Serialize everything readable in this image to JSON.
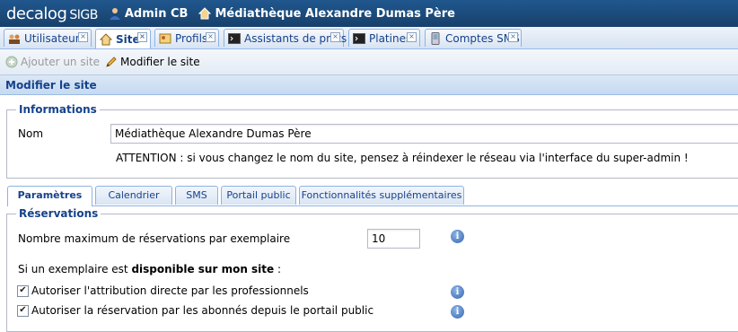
{
  "header": {
    "logo_main": "decalog",
    "logo_sub": "SIGB",
    "user": "Admin CB",
    "library": "Médiathèque Alexandre Dumas Père"
  },
  "tabs": [
    {
      "label": "Utilisateurs",
      "icon": "users-icon"
    },
    {
      "label": "Site",
      "icon": "home-icon",
      "active": true
    },
    {
      "label": "Profils",
      "icon": "profiles-icon"
    },
    {
      "label": "Assistants de prêts",
      "icon": "terminal-icon"
    },
    {
      "label": "Platines",
      "icon": "terminal-icon"
    },
    {
      "label": "Comptes SMS",
      "icon": "phone-icon"
    }
  ],
  "tab_close_glyph": "×",
  "toolbar": {
    "add_label": "Ajouter un site",
    "edit_label": "Modifier le site"
  },
  "panel": {
    "title": "Modifier le site"
  },
  "informations": {
    "legend": "Informations",
    "nom_label": "Nom",
    "nom_value": "Médiathèque Alexandre Dumas Père",
    "warning": "ATTENTION : si vous changez le nom du site, pensez à réindexer le réseau via l'interface du super-admin !"
  },
  "inner_tabs": [
    {
      "label": "Paramètres",
      "active": true
    },
    {
      "label": "Calendrier"
    },
    {
      "label": "SMS"
    },
    {
      "label": "Portail public"
    },
    {
      "label": "Fonctionnalités supplémentaires"
    }
  ],
  "reservations": {
    "legend": "Réservations",
    "max_label": "Nombre maximum de réservations par exemplaire",
    "max_value": "10",
    "condition_prefix": "Si un exemplaire est ",
    "condition_bold": "disponible sur mon site",
    "condition_suffix": " :",
    "option1": "Autoriser l'attribution directe par les professionnels",
    "option2": "Autoriser la réservation par les abonnés depuis le portail public"
  },
  "info_glyph": "i",
  "check_glyph": "✔"
}
